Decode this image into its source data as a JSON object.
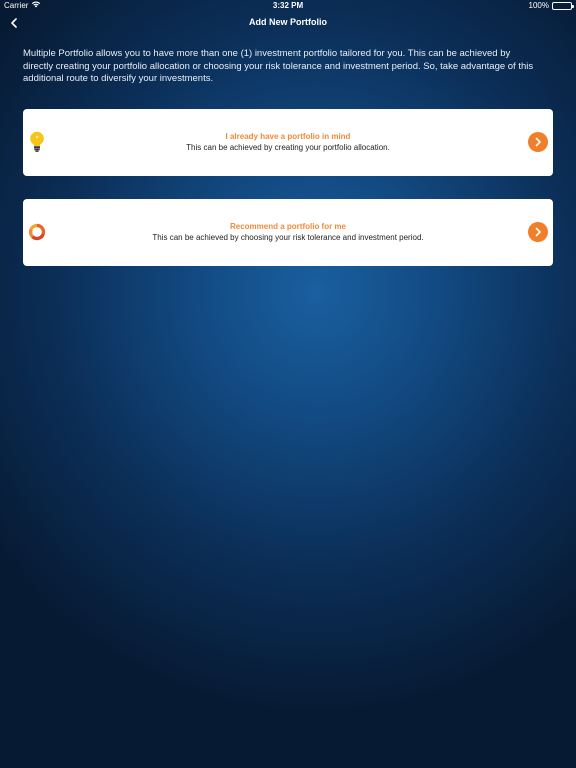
{
  "status_bar": {
    "carrier": "Carrier",
    "time": "3:32 PM",
    "battery": "100%"
  },
  "nav": {
    "title": "Add New Portfolio",
    "back_icon": "chevron-left-icon"
  },
  "intro": "Multiple Portfolio allows you to have more than one (1) investment portfolio tailored for you. This can be achieved by directly creating your portfolio allocation or choosing your risk tolerance and investment period. So, take advantage of this additional route to diversify your investments.",
  "options": [
    {
      "icon": "lightbulb-icon",
      "title": "I already have a portfolio in mind",
      "subtitle": "This can be achieved by creating your portfolio allocation."
    },
    {
      "icon": "donut-chart-icon",
      "title": "Recommend a portfolio for me",
      "subtitle": "This can be achieved by choosing your risk tolerance and investment period."
    }
  ],
  "colors": {
    "accent": "#f07f2a",
    "title_orange": "#f08a3a",
    "background_center": "#1a5fa0",
    "background_edge": "#071a33"
  }
}
